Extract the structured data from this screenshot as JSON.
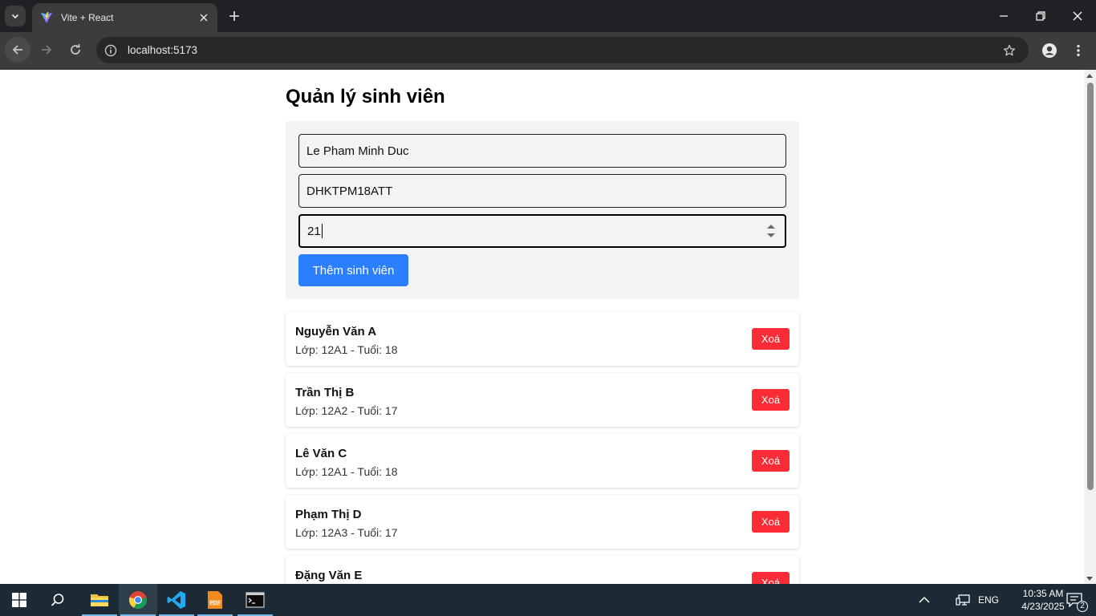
{
  "browser": {
    "tab_title": "Vite + React",
    "url": "localhost:5173"
  },
  "page": {
    "title": "Quản lý sinh viên",
    "form": {
      "name_value": "Le Pham Minh Duc",
      "class_value": "DHKTPM18ATT",
      "age_value": "21",
      "add_button": "Thêm sinh viên"
    },
    "students": [
      {
        "name": "Nguyễn Văn A",
        "info": "Lớp: 12A1 - Tuổi: 18",
        "delete_label": "Xoá"
      },
      {
        "name": "Trần Thị B",
        "info": "Lớp: 12A2 - Tuổi: 17",
        "delete_label": "Xoá"
      },
      {
        "name": "Lê Văn C",
        "info": "Lớp: 12A1 - Tuổi: 18",
        "delete_label": "Xoá"
      },
      {
        "name": "Phạm Thị D",
        "info": "Lớp: 12A3 - Tuổi: 17",
        "delete_label": "Xoá"
      },
      {
        "name": "Đặng Văn E",
        "info": "",
        "delete_label": "Xoá"
      }
    ]
  },
  "taskbar": {
    "language": "ENG",
    "time": "10:35 AM",
    "date": "4/23/2025",
    "notification_count": "2"
  },
  "colors": {
    "add_button": "#2b7fff",
    "delete_button": "#fb2c36",
    "form_background": "#f2f3f5"
  }
}
